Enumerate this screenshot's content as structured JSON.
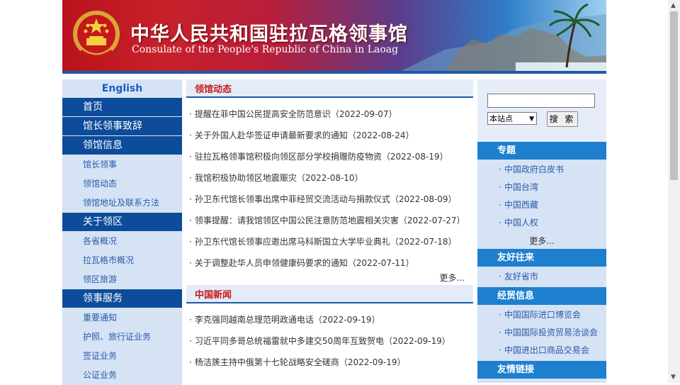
{
  "banner": {
    "title_cn": "中华人民共和国驻拉瓦格领事馆",
    "title_en": "Consulate of the People's Republic of China in Laoag"
  },
  "left_nav": {
    "lang": "English",
    "items": [
      {
        "label": "首页",
        "type": "main"
      },
      {
        "label": "馆长领事致辞",
        "type": "main"
      },
      {
        "label": "领馆信息",
        "type": "main"
      },
      {
        "label": "馆长领事",
        "type": "sub"
      },
      {
        "label": "领馆动态",
        "type": "sub"
      },
      {
        "label": "领馆地址及联系方法",
        "type": "sub"
      },
      {
        "label": "关于领区",
        "type": "main"
      },
      {
        "label": "各省概况",
        "type": "sub"
      },
      {
        "label": "拉瓦格市概况",
        "type": "sub"
      },
      {
        "label": "领区旅游",
        "type": "sub"
      },
      {
        "label": "领事服务",
        "type": "main"
      },
      {
        "label": "重要通知",
        "type": "sub"
      },
      {
        "label": "护照、旅行证业务",
        "type": "sub"
      },
      {
        "label": "签证业务",
        "type": "sub"
      },
      {
        "label": "公证业务",
        "type": "sub"
      }
    ]
  },
  "sections": {
    "consulate_news": {
      "title": "领馆动态",
      "items": [
        "提醒在菲中国公民提高安全防范意识（2022-09-07）",
        "关于外国人赴华签证申请最新要求的通知（2022-08-24）",
        "驻拉瓦格领事馆积极向领区部分学校捐赠防疫物资（2022-08-19）",
        "我馆积极协助领区地震赈灾（2022-08-10）",
        "孙卫东代馆长领事出席中菲经贸交流活动与捐款仪式（2022-08-09）",
        "领事提醒：请我馆领区中国公民注意防范地震相关灾害（2022-07-27）",
        "孙卫东代馆长领事应邀出席马科斯国立大学毕业典礼（2022-07-18）",
        "关于调整赴华人员申领健康码要求的通知（2022-07-11）"
      ],
      "more": "更多..."
    },
    "china_news": {
      "title": "中国新闻",
      "items": [
        "李克强同越南总理范明政通电话（2022-09-19）",
        "习近平同多哥总统福雷就中多建交50周年互致贺电（2022-09-19）",
        "杨洁篪主持中俄第十七轮战略安全磋商（2022-09-19）"
      ]
    }
  },
  "bullet": "·",
  "search": {
    "scope": "本站点",
    "button": "搜 索"
  },
  "right": {
    "topics": {
      "title": "专题",
      "items": [
        "中国政府白皮书",
        "中国台湾",
        "中国西藏",
        "中国人权"
      ],
      "more": "更多..."
    },
    "friendly": {
      "title": "友好往来",
      "items": [
        "友好省市"
      ]
    },
    "trade": {
      "title": "经贸信息",
      "items": [
        "中国国际进口博览会",
        "中国国际投资贸易洽谈会",
        "中国进出口商品交易会"
      ]
    },
    "links": {
      "title": "友情链接"
    }
  },
  "colors": {
    "nav_main": "#0d4c9a",
    "nav_bg": "#d6e3f5",
    "section_title": "#c41b1b",
    "right_head": "#1e7fcf"
  }
}
